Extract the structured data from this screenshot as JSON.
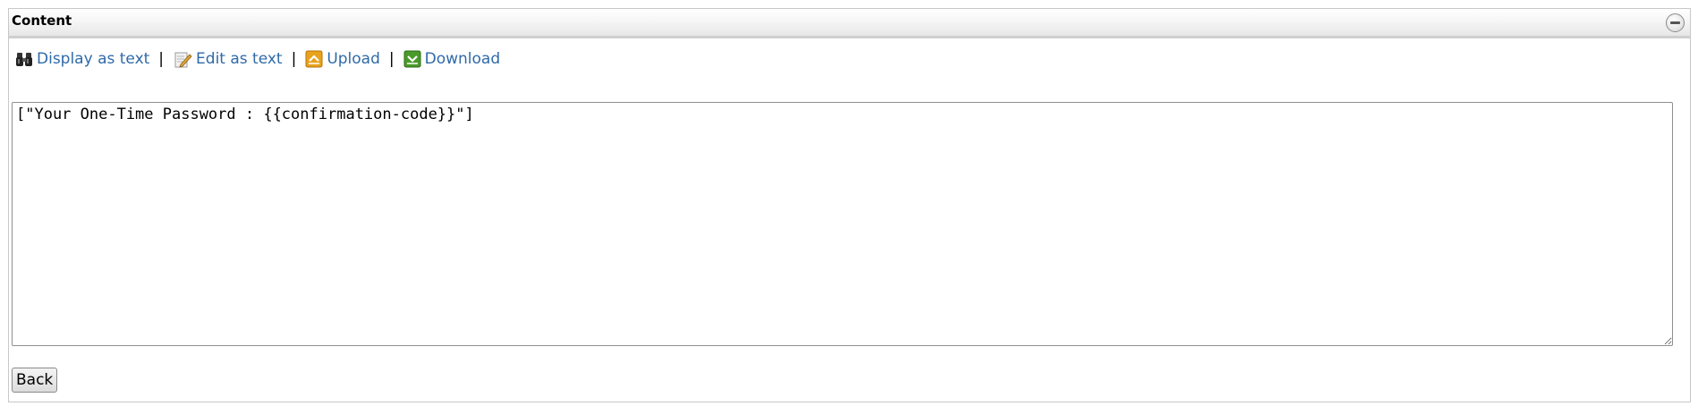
{
  "panel": {
    "title": "Content"
  },
  "toolbar": {
    "display_as_text": "Display as text",
    "edit_as_text": "Edit as text",
    "upload": "Upload",
    "download": "Download",
    "separator": "|"
  },
  "editor": {
    "value": "[\"Your One-Time Password : {{confirmation-code}}\"]"
  },
  "actions": {
    "back_label": "Back"
  },
  "colors": {
    "link": "#2f6aa8",
    "upload_icon": "#e8a21c",
    "download_icon": "#4a9a2a"
  },
  "icons": {
    "display": "binoculars-icon",
    "edit": "edit-document-icon",
    "upload": "upload-icon",
    "download": "download-icon",
    "collapse": "collapse-minus-icon"
  }
}
